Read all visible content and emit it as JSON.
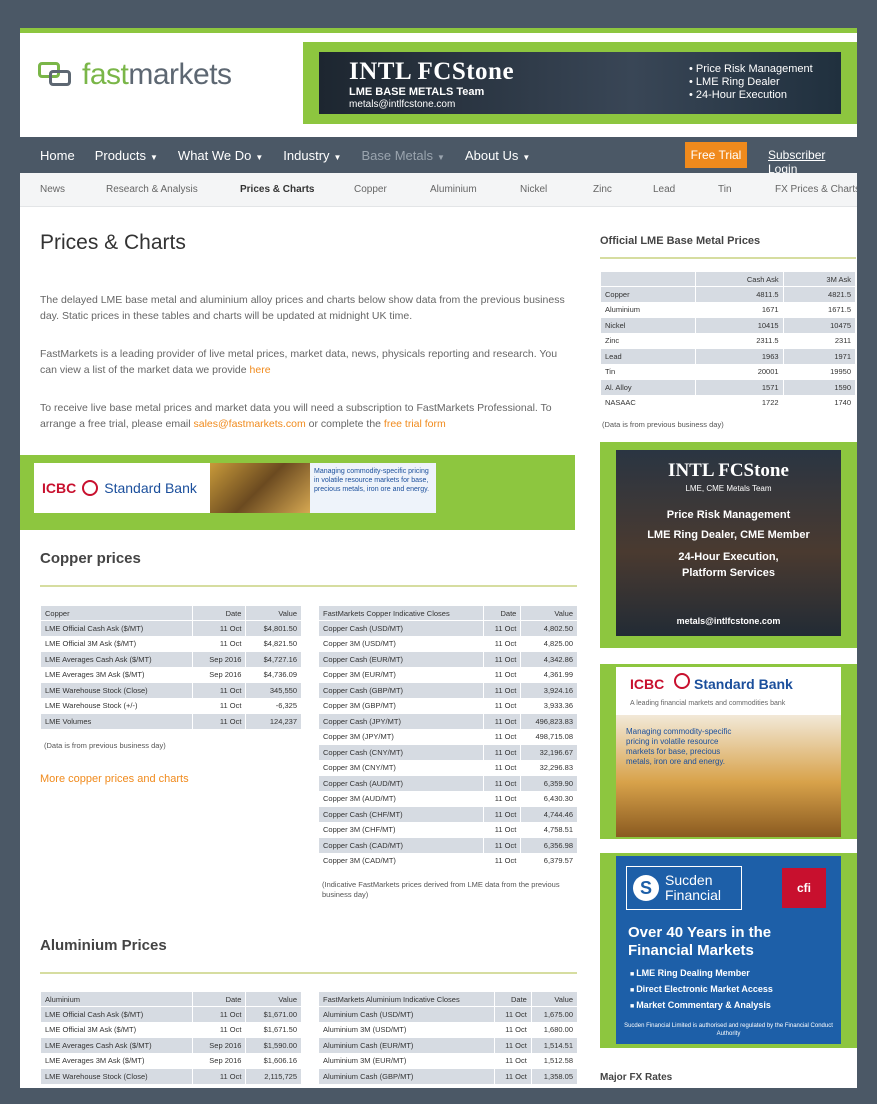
{
  "header": {
    "logo_fast": "fast",
    "logo_markets": "markets",
    "top_ad": {
      "brand": "INTL FCStone",
      "team": "LME BASE METALS Team",
      "email": "metals@intlfcstone.com",
      "bullets": [
        "• Price Risk Management",
        "• LME Ring Dealer",
        "• 24-Hour Execution"
      ]
    }
  },
  "nav": {
    "items": [
      "Home",
      "Products",
      "What We Do",
      "Industry",
      "Base Metals",
      "About Us"
    ],
    "free_trial": "Free Trial",
    "subscriber_login": "Subscriber Login"
  },
  "subnav": [
    "News",
    "Research & Analysis",
    "Prices & Charts",
    "Copper",
    "Aluminium",
    "Nickel",
    "Zinc",
    "Lead",
    "Tin",
    "FX Prices & Charts"
  ],
  "main": {
    "title": "Prices & Charts",
    "p1": "The delayed LME base metal and aluminium alloy prices and charts below show data from the previous business day. Static prices in these tables and charts will be updated at midnight UK time.",
    "p2_text": "FastMarkets is a leading provider of live metal prices, market data, news, physicals reporting and research. You can view a list of the market data we provide ",
    "p2_link": "here",
    "p3_text": "To receive live base metal prices and market data you will need a subscription to FastMarkets Professional. To arrange a free trial, please email ",
    "p3_email": "sales@fastmarkets.com",
    "p3_mid": " or complete the ",
    "p3_link": "free trial form",
    "mid_ad": {
      "icbc": "ICBC",
      "sb": "Standard Bank",
      "blurb": "Managing commodity-specific pricing in volatile resource markets for base, precious metals, iron ore and energy."
    },
    "copper_title": "Copper prices",
    "copper_lme": {
      "headers": [
        "Copper",
        "Date",
        "Value"
      ],
      "rows": [
        [
          "LME Official Cash Ask ($/MT)",
          "11 Oct",
          "$4,801.50"
        ],
        [
          "LME Official 3M Ask ($/MT)",
          "11 Oct",
          "$4,821.50"
        ],
        [
          "LME Averages Cash Ask ($/MT)",
          "Sep 2016",
          "$4,727.16"
        ],
        [
          "LME Averages 3M Ask ($/MT)",
          "Sep 2016",
          "$4,736.09"
        ],
        [
          "LME Warehouse Stock (Close)",
          "11 Oct",
          "345,550"
        ],
        [
          "LME Warehouse Stock (+/-)",
          "11 Oct",
          "-6,325"
        ],
        [
          "LME Volumes",
          "11 Oct",
          "124,237"
        ]
      ],
      "note": "(Data is from previous business day)"
    },
    "copper_ind": {
      "headers": [
        "FastMarkets Copper Indicative Closes",
        "Date",
        "Value"
      ],
      "rows": [
        [
          "Copper Cash (USD/MT)",
          "11 Oct",
          "4,802.50"
        ],
        [
          "Copper 3M (USD/MT)",
          "11 Oct",
          "4,825.00"
        ],
        [
          "Copper Cash (EUR/MT)",
          "11 Oct",
          "4,342.86"
        ],
        [
          "Copper 3M (EUR/MT)",
          "11 Oct",
          "4,361.99"
        ],
        [
          "Copper Cash (GBP/MT)",
          "11 Oct",
          "3,924.16"
        ],
        [
          "Copper 3M (GBP/MT)",
          "11 Oct",
          "3,933.36"
        ],
        [
          "Copper Cash (JPY/MT)",
          "11 Oct",
          "496,823.83"
        ],
        [
          "Copper 3M (JPY/MT)",
          "11 Oct",
          "498,715.08"
        ],
        [
          "Copper Cash (CNY/MT)",
          "11 Oct",
          "32,196.67"
        ],
        [
          "Copper 3M (CNY/MT)",
          "11 Oct",
          "32,296.83"
        ],
        [
          "Copper Cash (AUD/MT)",
          "11 Oct",
          "6,359.90"
        ],
        [
          "Copper 3M (AUD/MT)",
          "11 Oct",
          "6,430.30"
        ],
        [
          "Copper Cash (CHF/MT)",
          "11 Oct",
          "4,744.46"
        ],
        [
          "Copper 3M (CHF/MT)",
          "11 Oct",
          "4,758.51"
        ],
        [
          "Copper Cash (CAD/MT)",
          "11 Oct",
          "6,356.98"
        ],
        [
          "Copper 3M (CAD/MT)",
          "11 Oct",
          "6,379.57"
        ]
      ],
      "note": "(Indicative FastMarkets prices derived from LME data from the previous business day)"
    },
    "copper_more": "More copper prices and charts",
    "alu_title": "Aluminium Prices",
    "alu_lme": {
      "headers": [
        "Aluminium",
        "Date",
        "Value"
      ],
      "rows": [
        [
          "LME Official Cash Ask ($/MT)",
          "11 Oct",
          "$1,671.00"
        ],
        [
          "LME Official 3M Ask ($/MT)",
          "11 Oct",
          "$1,671.50"
        ],
        [
          "LME Averages Cash Ask ($/MT)",
          "Sep 2016",
          "$1,590.00"
        ],
        [
          "LME Averages 3M Ask ($/MT)",
          "Sep 2016",
          "$1,606.16"
        ],
        [
          "LME Warehouse Stock (Close)",
          "11 Oct",
          "2,115,725"
        ]
      ]
    },
    "alu_ind": {
      "headers": [
        "FastMarkets Aluminium Indicative Closes",
        "Date",
        "Value"
      ],
      "rows": [
        [
          "Aluminium Cash (USD/MT)",
          "11 Oct",
          "1,675.00"
        ],
        [
          "Aluminium 3M (USD/MT)",
          "11 Oct",
          "1,680.00"
        ],
        [
          "Aluminium Cash (EUR/MT)",
          "11 Oct",
          "1,514.51"
        ],
        [
          "Aluminium 3M (EUR/MT)",
          "11 Oct",
          "1,512.58"
        ],
        [
          "Aluminium Cash (GBP/MT)",
          "11 Oct",
          "1,358.05"
        ]
      ]
    }
  },
  "sidebar": {
    "lme_title": "Official LME Base Metal Prices",
    "lme_table": {
      "headers": [
        "",
        "Cash Ask",
        "3M Ask"
      ],
      "rows": [
        [
          "Copper",
          "4811.5",
          "4821.5"
        ],
        [
          "Aluminium",
          "1671",
          "1671.5"
        ],
        [
          "Nickel",
          "10415",
          "10475"
        ],
        [
          "Zinc",
          "2311.5",
          "2311"
        ],
        [
          "Lead",
          "1963",
          "1971"
        ],
        [
          "Tin",
          "20001",
          "19950"
        ],
        [
          "Al. Alloy",
          "1571",
          "1590"
        ],
        [
          "NASAAC",
          "1722",
          "1740"
        ]
      ],
      "note": "(Data is from previous business day)"
    },
    "ad1": {
      "brand": "INTL FCStone",
      "team": "LME, CME Metals Team",
      "lines": [
        "Price Risk Management",
        "LME Ring Dealer, CME Member",
        "24-Hour Execution,",
        "Platform Services"
      ],
      "email": "metals@intlfcstone.com"
    },
    "ad2": {
      "icbc": "ICBC",
      "sb": "Standard Bank",
      "tag": "A leading financial markets and commodities bank",
      "blurb": "Managing commodity-specific pricing in volatile resource markets for base, precious metals, iron ore and energy."
    },
    "ad3": {
      "logo_s": "S",
      "name1": "Sucden",
      "name2": "Financial",
      "cfi": "cfi",
      "headline1": "Over 40 Years in the",
      "headline2": "Financial Markets",
      "bullets": [
        "LME Ring Dealing Member",
        "Direct Electronic Market Access",
        "Market Commentary & Analysis"
      ],
      "fine": "Sucden Financial Limited is authorised and regulated by the Financial Conduct Authority"
    },
    "fx_title": "Major FX Rates"
  },
  "colors": {
    "nav_bg": "#4b5866",
    "accent_green": "#8dc63f",
    "accent_orange": "#f08a1c"
  }
}
